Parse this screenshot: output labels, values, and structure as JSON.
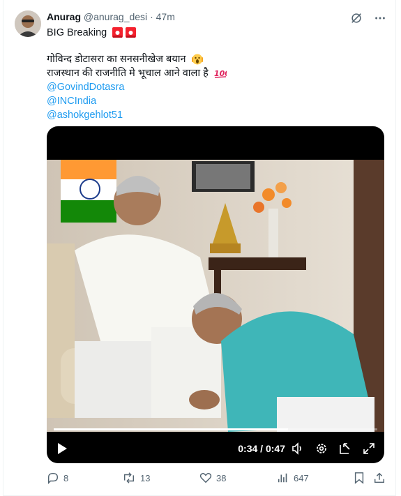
{
  "tweet": {
    "author_name": "Anurag",
    "author_handle": "@anurag_desi",
    "separator": "·",
    "time": "47m",
    "headline": "BIG Breaking",
    "line1": "गोविन्द  डोटासरा का सनसनीखेज बयान",
    "line2": "राजस्थान की राजनीति मे भूचाल आने वाला है",
    "mentions": [
      "@GovindDotasra",
      "@INCIndia",
      "@ashokgehlot51"
    ]
  },
  "video": {
    "current_time": "0:34",
    "time_sep": " / ",
    "duration": "0:47",
    "progress": 0.7234
  },
  "actions": {
    "replies": "8",
    "reposts": "13",
    "likes": "38",
    "views": "647"
  },
  "colors": {
    "link": "#1d9bf0",
    "muted": "#536471",
    "text": "#0f1419",
    "siren": "#f4212e"
  },
  "icons": {
    "header": [
      "grok-icon",
      "more-icon"
    ],
    "controls": [
      "play-icon",
      "volume-icon",
      "settings-icon",
      "popout-icon",
      "fullscreen-icon"
    ],
    "actions": [
      "reply-icon",
      "repost-icon",
      "like-icon",
      "views-icon",
      "bookmark-icon",
      "share-icon"
    ]
  }
}
